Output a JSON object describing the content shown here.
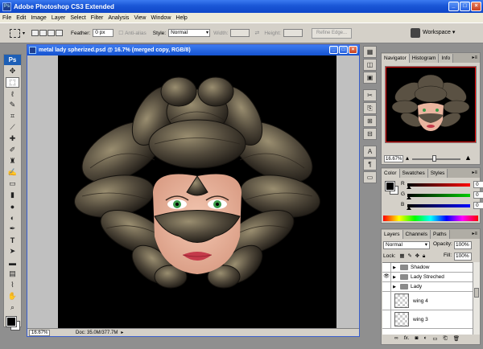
{
  "app": {
    "title": "Adobe Photoshop CS3 Extended",
    "logo": "Ps"
  },
  "menu": [
    "File",
    "Edit",
    "Image",
    "Layer",
    "Select",
    "Filter",
    "Analysis",
    "View",
    "Window",
    "Help"
  ],
  "options": {
    "feather_label": "Feather:",
    "feather_value": "0 px",
    "antialias_label": "Anti-alias",
    "style_label": "Style:",
    "style_value": "Normal",
    "width_label": "Width:",
    "height_label": "Height:",
    "refine_edge": "Refine Edge...",
    "workspace": "Workspace ▾"
  },
  "document": {
    "title": "metal lady spherized.psd @ 16.7% (merged copy, RGB/8)",
    "zoom": "16.67%",
    "doc_info": "Doc: 35.0M/377.7M"
  },
  "navigator": {
    "tabs": [
      "Navigator",
      "Histogram",
      "Info"
    ],
    "zoom": "16.67%"
  },
  "color": {
    "tabs": [
      "Color",
      "Swatches",
      "Styles"
    ],
    "channels": [
      {
        "label": "R",
        "value": "0",
        "color": "#ff0000"
      },
      {
        "label": "G",
        "value": "0",
        "color": "#00c000"
      },
      {
        "label": "B",
        "value": "0",
        "color": "#0000ff"
      }
    ]
  },
  "layers": {
    "tabs": [
      "Layers",
      "Channels",
      "Paths"
    ],
    "blend": "Normal",
    "opacity_label": "Opacity:",
    "opacity": "100%",
    "lock_label": "Lock:",
    "fill_label": "Fill:",
    "fill": "100%",
    "items": [
      {
        "name": "Shadow",
        "type": "group",
        "visible": false
      },
      {
        "name": "Lady Streched",
        "type": "group",
        "visible": true
      },
      {
        "name": "Lady",
        "type": "group",
        "visible": false
      },
      {
        "name": "wing 4",
        "type": "layer",
        "visible": false
      },
      {
        "name": "wing 3",
        "type": "layer",
        "visible": false
      }
    ]
  },
  "icons": {
    "close": "close-icon",
    "minimize": "minimize-icon",
    "maximize": "maximize-icon"
  }
}
